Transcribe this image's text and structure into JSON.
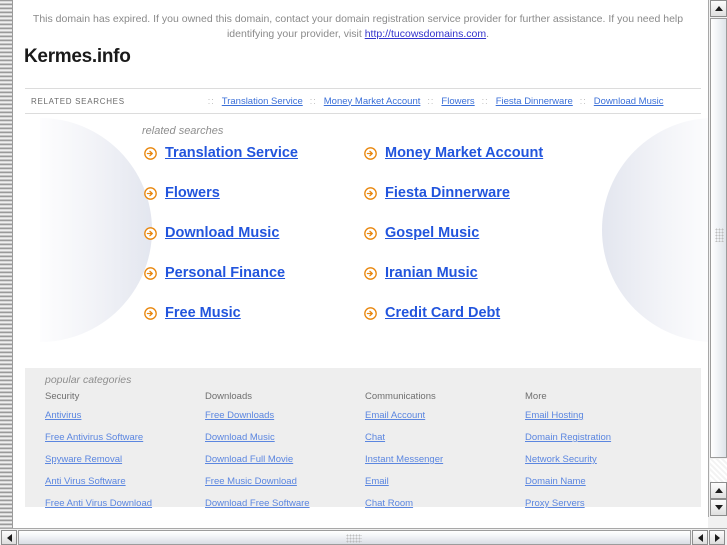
{
  "notice": {
    "text_before": "This domain has expired. If you owned this domain, contact your domain registration service provider for further assistance. If you need help identifying your provider, visit ",
    "link_text": "http://tucowsdomains.com",
    "text_after": "."
  },
  "domain_title": "Kermes.info",
  "top_nav": {
    "label": "RELATED SEARCHES",
    "separator": "::",
    "links": [
      "Translation Service",
      "Money Market Account",
      "Flowers",
      "Fiesta Dinnerware",
      "Download Music"
    ]
  },
  "related_searches": {
    "heading": "related searches",
    "rows": [
      {
        "left": "Translation Service",
        "right": "Money Market Account"
      },
      {
        "left": "Flowers",
        "right": "Fiesta Dinnerware"
      },
      {
        "left": "Download Music",
        "right": "Gospel Music"
      },
      {
        "left": "Personal Finance",
        "right": "Iranian Music"
      },
      {
        "left": "Free Music",
        "right": "Credit Card Debt"
      }
    ]
  },
  "popular_categories": {
    "heading": "popular categories",
    "columns": [
      {
        "title": "Security",
        "links": [
          "Antivirus",
          "Free Antivirus Software",
          "Spyware Removal",
          "Anti Virus Software",
          "Free Anti Virus Download"
        ]
      },
      {
        "title": "Downloads",
        "links": [
          "Free Downloads",
          "Download Music",
          "Download Full Movie",
          "Free Music Download",
          "Download Free Software"
        ]
      },
      {
        "title": "Communications",
        "links": [
          "Email Account",
          "Chat",
          "Instant Messenger",
          "Email",
          "Chat Room"
        ]
      },
      {
        "title": "More",
        "links": [
          "Email Hosting",
          "Domain Registration",
          "Network Security",
          "Domain Name",
          "Proxy Servers"
        ]
      }
    ]
  },
  "colors": {
    "link_blue": "#2255dd",
    "nav_link_blue": "#3a6fd8",
    "category_link_blue": "#5b86e0",
    "arrow_orange": "#e8860c",
    "panel_gray": "#eeeeee",
    "muted_text": "#8e8e8e"
  },
  "icons": {
    "arrow_circle": "arrow-circle-right-icon",
    "scroll_up": "triangle-up-icon",
    "scroll_down": "triangle-down-icon",
    "scroll_left": "triangle-left-icon",
    "scroll_right": "triangle-right-icon"
  }
}
